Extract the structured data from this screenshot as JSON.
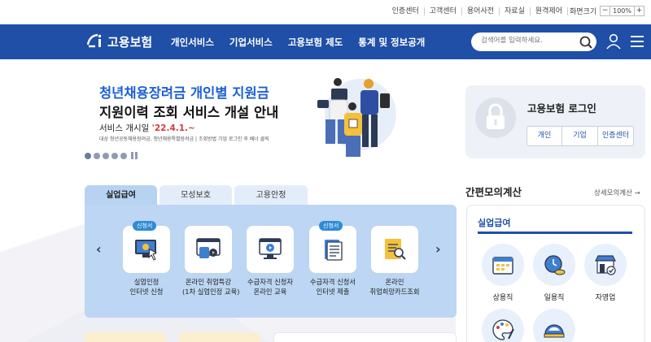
{
  "util": {
    "links": [
      "인증센터",
      "고객센터",
      "용어사전",
      "자료실",
      "원격제어"
    ],
    "zoom_label": "화면크기",
    "zoom_minus": "−",
    "zoom_value": "100%",
    "zoom_plus": "+"
  },
  "header": {
    "logo": "고용보험",
    "nav": [
      "개인서비스",
      "기업서비스",
      "고용보험 제도",
      "통계 및 정보공개"
    ],
    "search_placeholder": "검색어를 입력하세요."
  },
  "banner": {
    "line1": "청년채용장려금 개인별 지원금",
    "line2": "지원이력 조회 서비스 개설 안내",
    "line3_prefix": "서비스 개시일 ",
    "line3_date": "'22.4.1.~",
    "line4": "대상 청년공동채용장려금, 청년채용특별장려금 | 조회방법 기업 로그인 후 배너 클릭"
  },
  "login": {
    "title": "고용보험 로그인",
    "buttons": [
      "개인",
      "기업",
      "인증센터"
    ]
  },
  "tabs": [
    "실업급여",
    "모성보호",
    "고용안정"
  ],
  "services": [
    {
      "badge": "신청서",
      "line1": "실업인정",
      "line2": "인터넷 신청"
    },
    {
      "badge": "",
      "line1": "온라인 취업특강",
      "line2": "(1차 실업인정 교육)"
    },
    {
      "badge": "",
      "line1": "수급자격 신청자",
      "line2": "온라인 교육"
    },
    {
      "badge": "신청서",
      "line1": "수급자격 신청서",
      "line2": "인터넷 제출"
    },
    {
      "badge": "",
      "line1": "온라인",
      "line2": "취업희망카드조회"
    }
  ],
  "calc": {
    "title": "간편모의계산",
    "more": "상세모의계산 →",
    "tab": "실업급여",
    "items": [
      "상용직",
      "일용직",
      "자영업",
      "",
      ""
    ]
  },
  "colors": {
    "header_bg": "#1f4fa6",
    "accent_blue": "#1c5fd6",
    "highlight_red": "#d43c3c",
    "panel_bg": "#bcd6f3"
  }
}
